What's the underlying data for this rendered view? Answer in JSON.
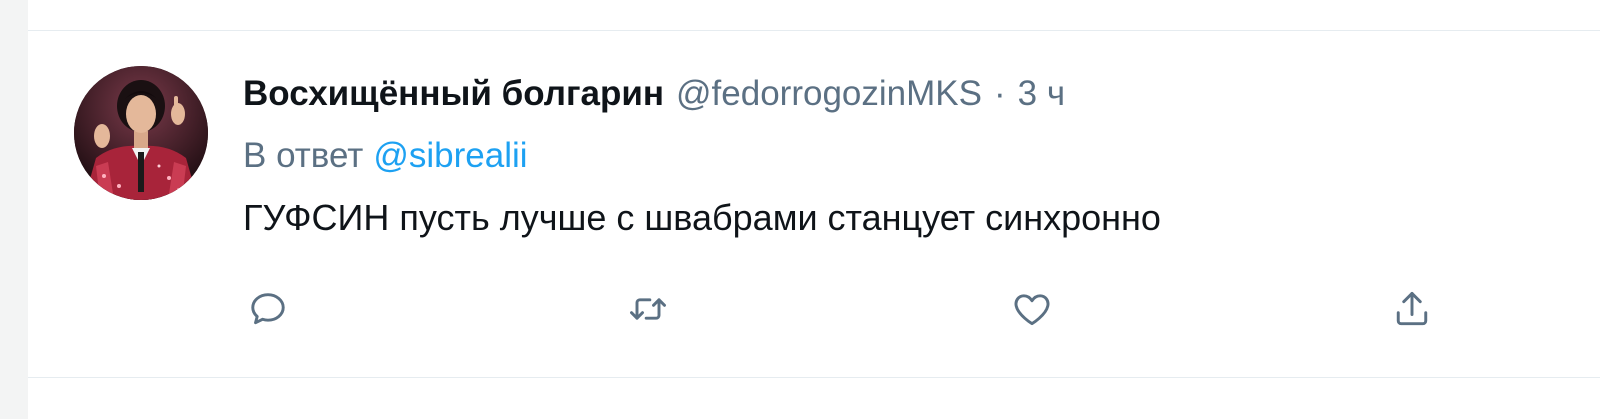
{
  "tweet": {
    "author": {
      "display_name": "Восхищённый болгарин",
      "handle": "@fedorrogozinMKS",
      "separator": "·",
      "time": "3 ч"
    },
    "reply_prefix": "В ответ",
    "reply_mention": "@sibrealii",
    "text": "ГУФСИН пусть лучше с швабрами станцует синхронно",
    "actions": [
      {
        "name": "reply",
        "icon": "speech-bubble-icon"
      },
      {
        "name": "retweet",
        "icon": "retweet-arrows-icon"
      },
      {
        "name": "like",
        "icon": "heart-icon"
      },
      {
        "name": "share",
        "icon": "share-upload-icon"
      }
    ]
  },
  "colors": {
    "primary_text": "#0f1419",
    "secondary_text": "#5b7083",
    "link": "#1da1f2",
    "divider": "#e6ecf0",
    "background": "#ffffff"
  }
}
